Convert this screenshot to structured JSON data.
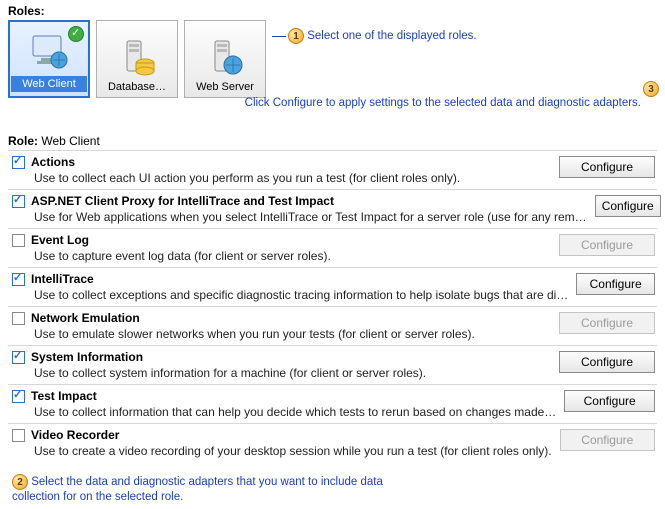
{
  "labels": {
    "roles_section": "Roles:",
    "role_heading_prefix": "Role:",
    "selected_role": "Web Client",
    "configure_btn": "Configure"
  },
  "roles": [
    {
      "id": "web-client",
      "label": "Web Client",
      "selected": true,
      "badge": true
    },
    {
      "id": "database",
      "label": "Database…",
      "selected": false,
      "badge": false
    },
    {
      "id": "web-server",
      "label": "Web Server",
      "selected": false,
      "badge": false
    }
  ],
  "annotations": {
    "n1": "Select one of the displayed roles.",
    "n2": "Select the data and diagnostic adapters that you want to include data collection for on the selected role.",
    "n3": "Click Configure to apply settings to the selected data and diagnostic adapters."
  },
  "adapters": [
    {
      "checked": true,
      "enabled": true,
      "title": "Actions",
      "desc": "Use to collect each UI action you perform as you run a test (for client roles only)."
    },
    {
      "checked": true,
      "enabled": true,
      "title": "ASP.NET Client Proxy for IntelliTrace and Test Impact",
      "desc": "Use for Web applications when you select IntelliTrace or Test Impact for a server role (use for any rem…"
    },
    {
      "checked": false,
      "enabled": false,
      "title": "Event Log",
      "desc": "Use to capture event log data (for client or server roles)."
    },
    {
      "checked": true,
      "enabled": true,
      "title": "IntelliTrace",
      "desc": "Use to collect exceptions and specific diagnostic tracing information to help isolate bugs that are di…"
    },
    {
      "checked": false,
      "enabled": false,
      "title": "Network Emulation",
      "desc": "Use to emulate slower networks when you run your tests (for client or server roles)."
    },
    {
      "checked": true,
      "enabled": true,
      "title": "System Information",
      "desc": "Use to collect system information for a machine (for client or server roles)."
    },
    {
      "checked": true,
      "enabled": true,
      "title": "Test Impact",
      "desc": "Use to collect information that can help you decide which tests to rerun based on changes made…"
    },
    {
      "checked": false,
      "enabled": false,
      "title": "Video Recorder",
      "desc": "Use to create a video recording of your desktop session while you run a test (for client roles only)."
    }
  ]
}
